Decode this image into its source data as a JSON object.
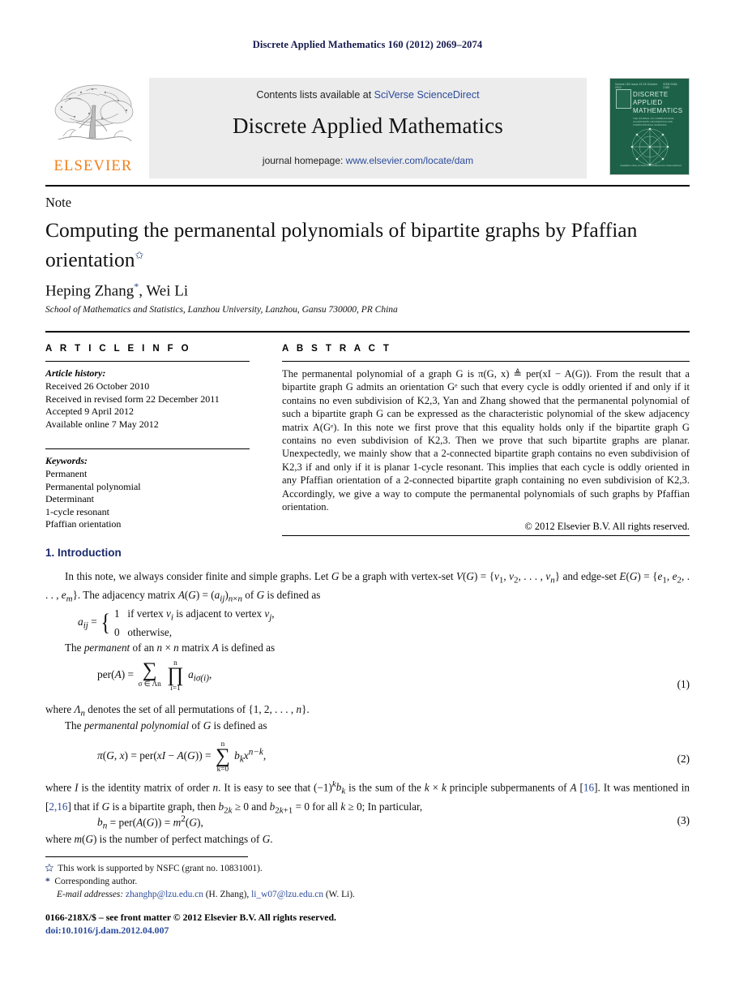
{
  "running_head": "Discrete Applied Mathematics 160 (2012) 2069–2074",
  "masthead": {
    "publisher_name": "ELSEVIER",
    "contents_prefix": "Contents lists available at ",
    "contents_link": "SciVerse ScienceDirect",
    "journal_title": "Discrete Applied Mathematics",
    "homepage_prefix": "journal homepage: ",
    "homepage_link": "www.elsevier.com/locate/dam",
    "cover": {
      "top_left": "Volume 160  Issue 15  15 October 2012",
      "top_right": "ISSN 0166-218X",
      "title": "DISCRETE APPLIED MATHEMATICS",
      "subtitle": "THE JOURNAL OF COMBINATORIAL ALGORITHMS, INFORMATICS AND COMPUTATIONAL SCIENCES",
      "footer": "Available online at www.sciencedirect.com\nScienceDirect"
    }
  },
  "article": {
    "doctype": "Note",
    "title": "Computing the permanental polynomials of bipartite graphs by Pfaffian orientation",
    "title_footnote_mark": "✩",
    "authors": "Heping Zhang",
    "authors_mark": "*",
    "authors_rest": ", Wei Li",
    "affiliation": "School of Mathematics and Statistics, Lanzhou University, Lanzhou, Gansu 730000, PR China"
  },
  "info": {
    "heading": "A R T I C L E   I N F O",
    "history_label": "Article history:",
    "history": [
      "Received 26 October 2010",
      "Received in revised form 22 December 2011",
      "Accepted 9 April 2012",
      "Available online 7 May 2012"
    ],
    "keywords_label": "Keywords:",
    "keywords": [
      "Permanent",
      "Permanental polynomial",
      "Determinant",
      "1-cycle resonant",
      "Pfaffian orientation"
    ]
  },
  "abstract": {
    "heading": "A B S T R A C T",
    "text": "The permanental polynomial of a graph G is π(G, x) ≜ per(xI − A(G)). From the result that a bipartite graph G admits an orientation Gᵉ such that every cycle is oddly oriented if and only if it contains no even subdivision of K2,3, Yan and Zhang showed that the permanental polynomial of such a bipartite graph G can be expressed as the characteristic polynomial of the skew adjacency matrix A(Gᵉ). In this note we first prove that this equality holds only if the bipartite graph G contains no even subdivision of K2,3. Then we prove that such bipartite graphs are planar. Unexpectedly, we mainly show that a 2-connected bipartite graph contains no even subdivision of K2,3 if and only if it is planar 1-cycle resonant. This implies that each cycle is oddly oriented in any Pfaffian orientation of a 2-connected bipartite graph containing no even subdivision of K2,3. Accordingly, we give a way to compute the permanental polynomials of such graphs by Pfaffian orientation.",
    "copyright": "© 2012 Elsevier B.V. All rights reserved."
  },
  "body": {
    "section1_heading": "1. Introduction",
    "para1_a": "In this note, we always consider finite and simple graphs. Let G be a graph with vertex-set V(G) = {v",
    "para1_full": "In this note, we always consider finite and simple graphs. Let G be a graph with vertex-set V(G) = {v1, v2, . . . , vn} and edge-set E(G) = {e1, e2, . . . , em}. The adjacency matrix A(G) = (aij)n×n of G is defined as",
    "cases_lhs": "aij =",
    "cases_line1": "if vertex vi is adjacent to vertex vj,",
    "cases_line2": "otherwise,",
    "cases_val1": "1",
    "cases_val2": "0",
    "para2": "The permanent of an n × n matrix A is defined as",
    "eq1_lhs": "per(A) =",
    "eq1_sum_top": "",
    "eq1_sum_bottom": "σ ∈ Λn",
    "eq1_prod_top": "n",
    "eq1_prod_bottom": "i=1",
    "eq1_term": "aiσ(i),",
    "eq1_num": "(1)",
    "para3": "where Λn denotes the set of all permutations of {1, 2, . . . , n}.",
    "para4": "The permanental polynomial of G is defined as",
    "eq2_lhs": "π(G, x) = per(xI − A(G)) =",
    "eq2_sum_top": "n",
    "eq2_sum_bottom": "k=0",
    "eq2_term": "bkxn−k,",
    "eq2_num": "(2)",
    "para5_part1": "where I is the identity matrix of order n. It is easy to see that (−1)",
    "para5_sup": "k",
    "para5_part2": "bk is the sum of the k × k principle subpermanents of A",
    "para5_cite1": "[16]",
    "para5_part3": ". It was mentioned in ",
    "para5_cite2": "[2,16]",
    "para5_part4": " that if G is a bipartite graph, then b2k ≥ 0 and b2k+1 = 0 for all k ≥ 0; In particular,",
    "eq3": "bn = per(A(G)) = m2(G),",
    "eq3_num": "(3)",
    "para6": "where m(G) is the number of perfect matchings of G."
  },
  "footnotes": {
    "star_mark": "✩",
    "star_text": "This work is supported by NSFC (grant no. 10831001).",
    "corr_mark": "*",
    "corr_text": "Corresponding author.",
    "email_label": "E-mail addresses:",
    "email1": "zhanghp@lzu.edu.cn",
    "email1_name": "(H. Zhang)",
    "email2": "li_w07@lzu.edu.cn",
    "email2_name": "(W. Li).",
    "issn_line": "0166-218X/$ – see front matter © 2012 Elsevier B.V. All rights reserved.",
    "doi_line": "doi:10.1016/j.dam.2012.04.007"
  },
  "colors": {
    "link": "#2b4b9b",
    "heading": "#1b2a6b",
    "elsevier_orange": "#f07f19",
    "cover_green": "#1d6149"
  }
}
